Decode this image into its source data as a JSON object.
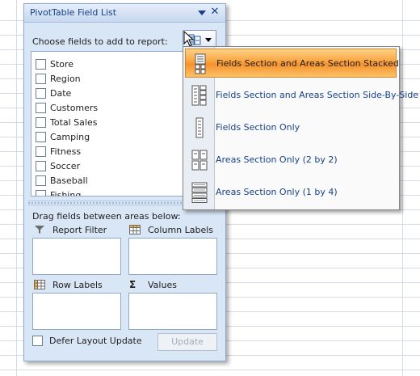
{
  "pane": {
    "title": "PivotTable Field List",
    "choose_label": "Choose fields to add to report:",
    "fields": [
      "Store",
      "Region",
      "Date",
      "Customers",
      "Total Sales",
      "Camping",
      "Fitness",
      "Soccer",
      "Baseball",
      "Fishing"
    ],
    "drag_label": "Drag fields between areas below:",
    "areas": {
      "report_filter": "Report Filter",
      "column_labels": "Column Labels",
      "row_labels": "Row Labels",
      "values": "Values"
    },
    "defer_label": "Defer Layout Update",
    "update_label": "Update"
  },
  "layout_menu": {
    "items": [
      {
        "label": "Fields Section and Areas Section Stacked",
        "selected": true
      },
      {
        "label": "Fields Section and Areas Section Side-By-Side",
        "selected": false
      },
      {
        "label": "Fields Section Only",
        "selected": false
      },
      {
        "label": "Areas Section Only (2 by 2)",
        "selected": false
      },
      {
        "label": "Areas Section Only (1 by 4)",
        "selected": false
      }
    ]
  },
  "colors": {
    "accent_title": "#15428b",
    "pane_bg": "#d9e6f5",
    "selected_item": "#f99d35"
  }
}
